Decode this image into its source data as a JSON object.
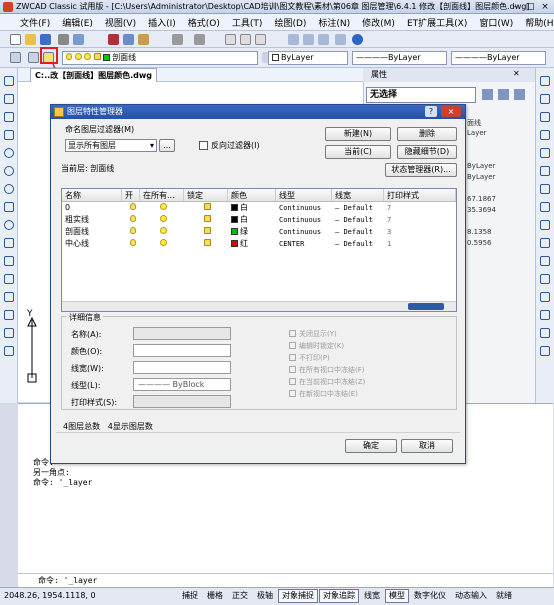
{
  "window": {
    "title": "ZWCAD Classic 试用版 - [C:\\Users\\Administrator\\Desktop\\CAD培训\\图文教程\\素材\\第06章 图层管理\\6.4.1 修改【剖面线】图层颜色.dwg]"
  },
  "menu": [
    "文件(F)",
    "编辑(E)",
    "视图(V)",
    "插入(I)",
    "格式(O)",
    "工具(T)",
    "绘图(D)",
    "标注(N)",
    "修改(M)",
    "ET扩展工具(X)",
    "窗口(W)",
    "帮助(H)"
  ],
  "toolbar": {
    "layer_combo": "剖面线",
    "color_combo": "ByLayer",
    "linetype_combo": "ByLayer",
    "lineweight_combo": "ByLayer"
  },
  "doc_tab": {
    "label": "C:..改【剖面线】图层颜色.dwg"
  },
  "properties": {
    "title": "属性",
    "selection": "无选择",
    "values": [
      "面线",
      "Layer",
      "ByLayer",
      "ByLayer",
      "67.1867",
      "35.3694",
      "8.1358",
      "0.5956"
    ]
  },
  "dialog": {
    "title": "图层特性管理器",
    "filter_label": "命名图层过滤器(M)",
    "filter_value": "显示所有图层",
    "filter_more": "...",
    "invert_label": "反向过滤器(I)",
    "buttons": {
      "new": "新建(N)",
      "delete": "删除",
      "current": "当前(C)",
      "hide_details": "隐藏细节(D)",
      "state_manager": "状态管理器(R)..."
    },
    "current_layer": "当前层: 剖面线",
    "columns": [
      "名称",
      "开",
      "在所有...",
      "锁定",
      "颜色",
      "线型",
      "线宽",
      "打印样式"
    ],
    "layers": [
      {
        "name": "0",
        "color_name": "白",
        "color": "#000000",
        "linetype": "Continuous",
        "lineweight": "Default",
        "plot": "7"
      },
      {
        "name": "粗实线",
        "color_name": "白",
        "color": "#000000",
        "linetype": "Continuous",
        "lineweight": "Default",
        "plot": "7"
      },
      {
        "name": "剖面线",
        "color_name": "绿",
        "color": "#00c000",
        "linetype": "Continuous",
        "lineweight": "Default",
        "plot": "3"
      },
      {
        "name": "中心线",
        "color_name": "红",
        "color": "#e00000",
        "linetype": "CENTER",
        "lineweight": "Default",
        "plot": "1"
      }
    ],
    "details": {
      "title": "详细信息",
      "name_label": "名称(A):",
      "color_label": "颜色(O):",
      "lineweight_label": "线宽(W):",
      "linetype_label": "线型(L):",
      "linetype_value": "ByBlock",
      "plotstyle_label": "打印样式(S):",
      "options": [
        "关闭显示(Y)",
        "编辑时锁定(K)",
        "不打印(P)",
        "在所有视口中冻结(F)",
        "在当前视口中冻结(Z)",
        "在新视口中冻结(E)"
      ]
    },
    "total_layers": "4图层总数",
    "shown_layers": "4显示图层数",
    "ok": "确定",
    "cancel": "取消"
  },
  "command": {
    "history": [
      "命令:",
      "另一角点:",
      "命令: '_layer"
    ],
    "current": "命令: '_layer"
  },
  "status": {
    "coords": "2048.26, 1954.1118, 0",
    "items": [
      "捕捉",
      "栅格",
      "正交",
      "极轴",
      "对象捕捉",
      "对象追踪",
      "线宽",
      "模型",
      "数字化仪",
      "动态输入",
      "就绪"
    ]
  }
}
